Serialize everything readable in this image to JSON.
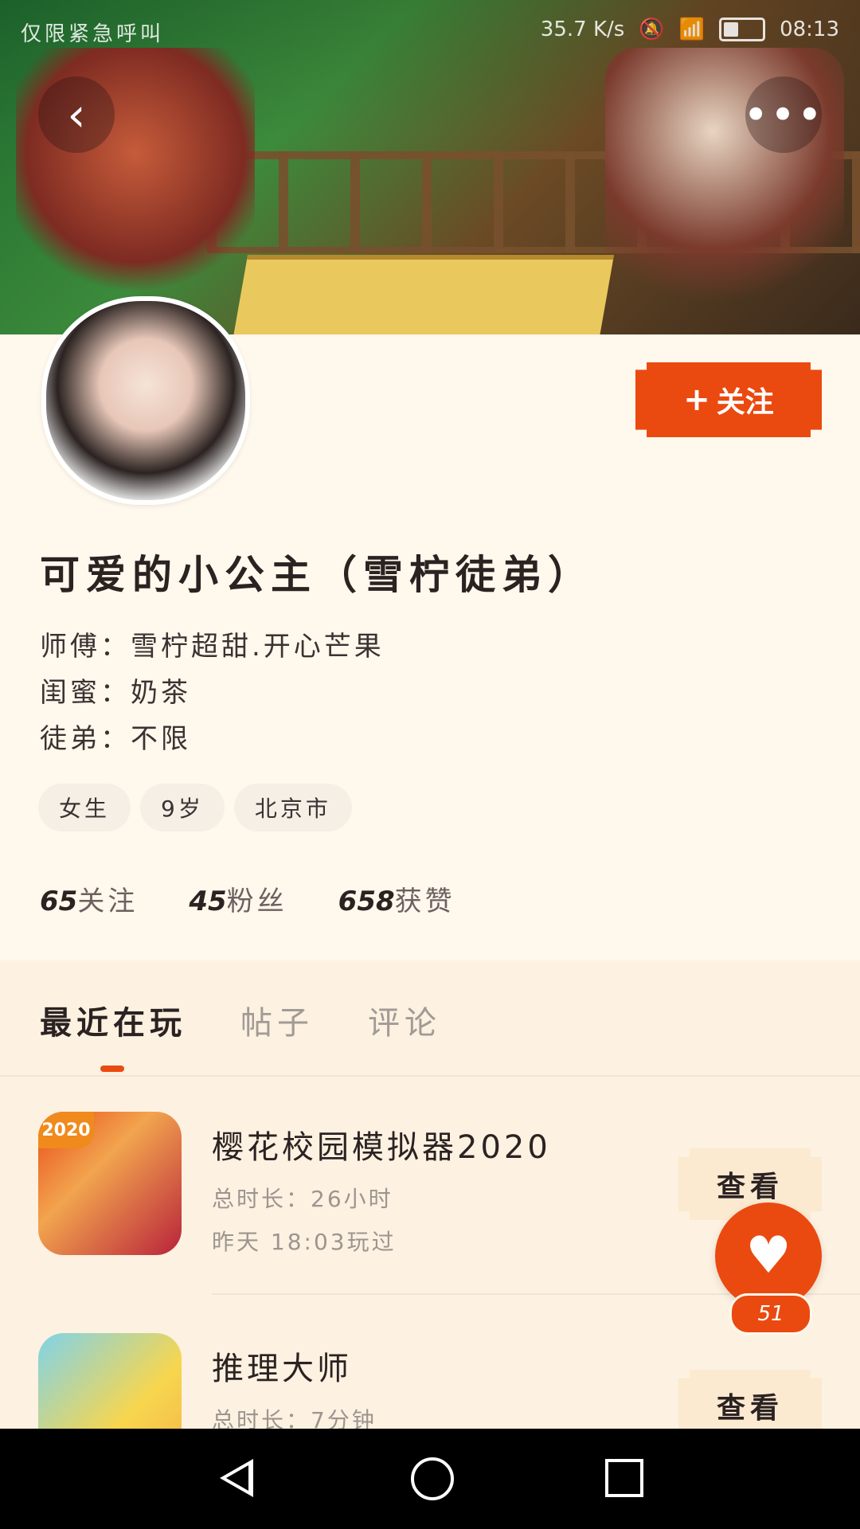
{
  "status_bar": {
    "left_text": "仅限紧急呼叫",
    "speed": "35.7 K/s",
    "time": "08:13"
  },
  "header": {
    "back_icon": "back-icon",
    "more_icon": "more-icon"
  },
  "profile": {
    "name": "可爱的小公主（雪柠徒弟）",
    "follow_label": "关注",
    "info": [
      "师傅：雪柠超甜.开心芒果",
      "闺蜜：奶茶",
      "徒弟：不限"
    ],
    "chips": [
      "女生",
      "9岁",
      "北京市"
    ],
    "stats": [
      {
        "num": "65",
        "label": "关注"
      },
      {
        "num": "45",
        "label": "粉丝"
      },
      {
        "num": "658",
        "label": "获赞"
      }
    ]
  },
  "tabs": [
    {
      "label": "最近在玩"
    },
    {
      "label": "帖子"
    },
    {
      "label": "评论"
    }
  ],
  "games": [
    {
      "title": "樱花校园模拟器2020",
      "badge": "2020",
      "meta1": "总时长：26小时",
      "meta2": "昨天 18:03玩过",
      "button": "查看"
    },
    {
      "title": "推理大师",
      "meta1": "总时长：7分钟",
      "button": "查看"
    }
  ],
  "like": {
    "count": "51"
  },
  "colors": {
    "accent": "#ea4a10",
    "background": "#fff8ec"
  }
}
